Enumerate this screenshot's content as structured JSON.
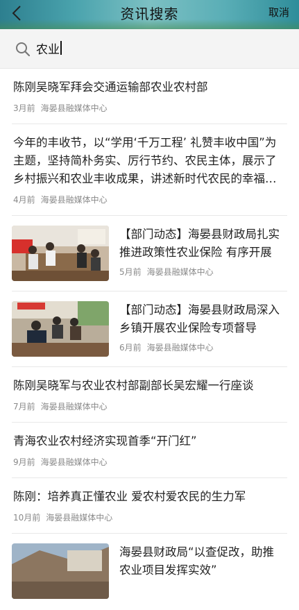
{
  "header": {
    "title": "资讯搜索",
    "cancel_label": "取消"
  },
  "search": {
    "value": "农业"
  },
  "news": [
    {
      "title": "陈刚吴晓军拜会交通运输部农业农村部",
      "time": "3月前",
      "source": "海晏县融媒体中心"
    },
    {
      "title": "今年的丰收节，以“学用‘千万工程’ 礼赞丰收中国”为主题，坚持简朴务实、厉行节约、农民主体，展示了乡村振兴和农业丰收成果，讲述新时代农民的幸福生活...",
      "time": "4月前",
      "source": "海晏县融媒体中心"
    },
    {
      "title": "【部门动态】海晏县财政局扎实推进政策性农业保险 有序开展",
      "time": "5月前",
      "source": "海晏县融媒体中心"
    },
    {
      "title": "【部门动态】海晏县财政局深入乡镇开展农业保险专项督导",
      "time": "6月前",
      "source": "海晏县融媒体中心"
    },
    {
      "title": "陈刚吴晓军与农业农村部副部长吴宏耀一行座谈",
      "time": "7月前",
      "source": "海晏县融媒体中心"
    },
    {
      "title": "青海农业农村经济实现首季“开门红”",
      "time": "9月前",
      "source": "海晏县融媒体中心"
    },
    {
      "title": "陈刚：培养真正懂农业 爱农村爱农民的生力军",
      "time": "10月前",
      "source": "海晏县融媒体中心"
    },
    {
      "title": "海晏县财政局“以查促改，助推农业项目发挥实效”",
      "time": "",
      "source": ""
    }
  ]
}
